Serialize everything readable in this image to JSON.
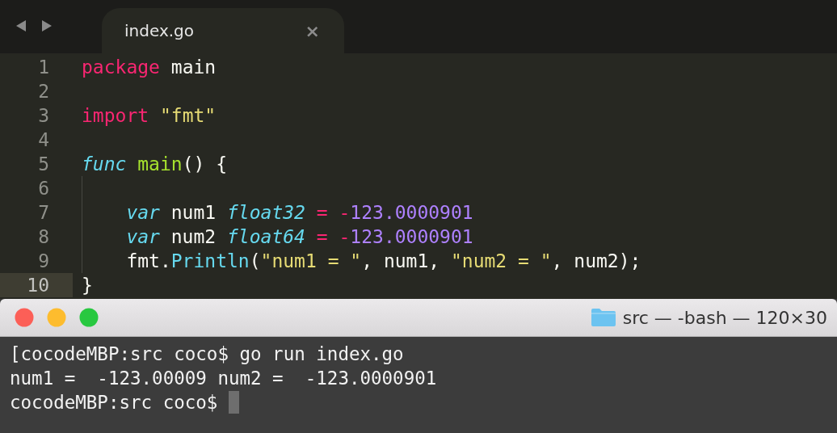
{
  "editor": {
    "tabs": [
      {
        "label": "index.go",
        "selected": true,
        "close": "×"
      }
    ],
    "lines": [
      {
        "number": "1",
        "current": false,
        "indented": false,
        "tokens": [
          {
            "kind": "keyword",
            "text": "package"
          },
          {
            "kind": "plain",
            "text": " main"
          }
        ]
      },
      {
        "number": "2",
        "current": false
      },
      {
        "number": "3",
        "current": false,
        "indented": false,
        "tokens": [
          {
            "kind": "keyword",
            "text": "import"
          },
          {
            "kind": "string",
            "text": " \"fmt\""
          }
        ]
      },
      {
        "number": "4",
        "current": false
      },
      {
        "number": "5",
        "current": false,
        "indented": false,
        "tokens": [
          {
            "kind": "storage",
            "text": "func"
          },
          {
            "kind": "function",
            "text": " main"
          },
          {
            "kind": "plain",
            "text": "() {"
          }
        ]
      },
      {
        "number": "6",
        "current": false
      },
      {
        "number": "7",
        "current": false,
        "indented": true,
        "tokens": [
          {
            "kind": "storage",
            "text": "var"
          },
          {
            "kind": "plain",
            "text": " num1 "
          },
          {
            "kind": "storage",
            "text": "float32"
          },
          {
            "kind": "operator",
            "text": " = -"
          },
          {
            "kind": "number",
            "text": "123.0000901"
          }
        ]
      },
      {
        "number": "8",
        "current": false,
        "indented": true,
        "tokens": [
          {
            "kind": "storage",
            "text": "var"
          },
          {
            "kind": "plain",
            "text": " num2 "
          },
          {
            "kind": "storage",
            "text": "float64"
          },
          {
            "kind": "operator",
            "text": " = -"
          },
          {
            "kind": "number",
            "text": "123.0000901"
          }
        ]
      },
      {
        "number": "9",
        "current": false,
        "indented": true,
        "tokens": [
          {
            "kind": "plain",
            "text": "fmt."
          },
          {
            "kind": "support",
            "text": "Println"
          },
          {
            "kind": "plain",
            "text": "("
          },
          {
            "kind": "string",
            "text": "\"num1 = \""
          },
          {
            "kind": "plain",
            "text": ", num1, "
          },
          {
            "kind": "string",
            "text": "\"num2 = \""
          },
          {
            "kind": "plain",
            "text": ", num2);"
          }
        ]
      },
      {
        "number": "10",
        "current": true,
        "indented": false,
        "tokens": [
          {
            "kind": "plain",
            "text": "}"
          }
        ]
      }
    ]
  },
  "terminal": {
    "title": "src — -bash — 120×30",
    "lines": [
      "[cocodeMBP:src coco$ go run index.go",
      "num1 =  -123.00009 num2 =  -123.0000901",
      "cocodeMBP:src coco$"
    ]
  }
}
